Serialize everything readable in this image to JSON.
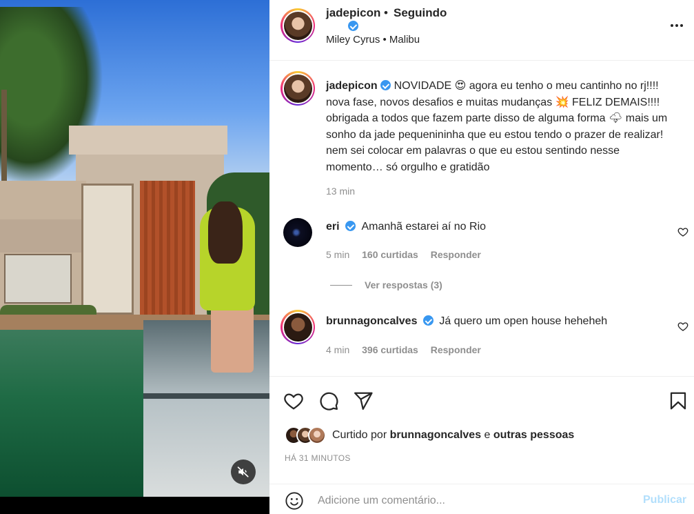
{
  "post": {
    "author": "jadepicon",
    "follow_label": "Seguindo",
    "separator": "•",
    "location": "Miley Cyrus • Malibu",
    "caption": {
      "username": "jadepicon",
      "text": "NOVIDADE 😍 agora eu tenho o meu cantinho no rj!!!! nova fase, novos desafios e muitas mudanças 💥 FELIZ DEMAIS!!!! obrigada a todos que fazem parte disso de alguma forma 🌩 mais um sonho da jade pequenininha que eu estou tendo o prazer de realizar! nem sei colocar em palavras o que eu estou sentindo nesse momento… só orgulho e gratidão",
      "time": "13 min"
    },
    "comments": [
      {
        "username": "eri",
        "text": "Amanhã estarei aí no Rio",
        "time": "5 min",
        "likes": "160 curtidas",
        "reply_label": "Responder",
        "view_replies": "Ver respostas (3)"
      },
      {
        "username": "brunnagoncalves",
        "text": "Já quero um open house heheheh",
        "time": "4 min",
        "likes": "396 curtidas",
        "reply_label": "Responder"
      }
    ],
    "liked_by": {
      "prefix": "Curtido por",
      "user": "brunnagoncalves",
      "joiner": "e",
      "others": "outras pessoas"
    },
    "posted_ago": "HÁ 31 MINUTOS",
    "add_comment": {
      "placeholder": "Adicione um comentário...",
      "publish_label": "Publicar"
    }
  },
  "icons": {
    "verified": "verified-badge-icon",
    "more": "more-options-icon",
    "like": "heart-icon",
    "comment": "comment-bubble-icon",
    "share": "paper-plane-icon",
    "save": "bookmark-icon",
    "emoji": "emoji-icon",
    "mute": "speaker-muted-icon"
  },
  "colors": {
    "text": "#262626",
    "secondary": "#8e8e8e",
    "verified": "#3897f0",
    "publish_disabled": "#b2dffc"
  }
}
